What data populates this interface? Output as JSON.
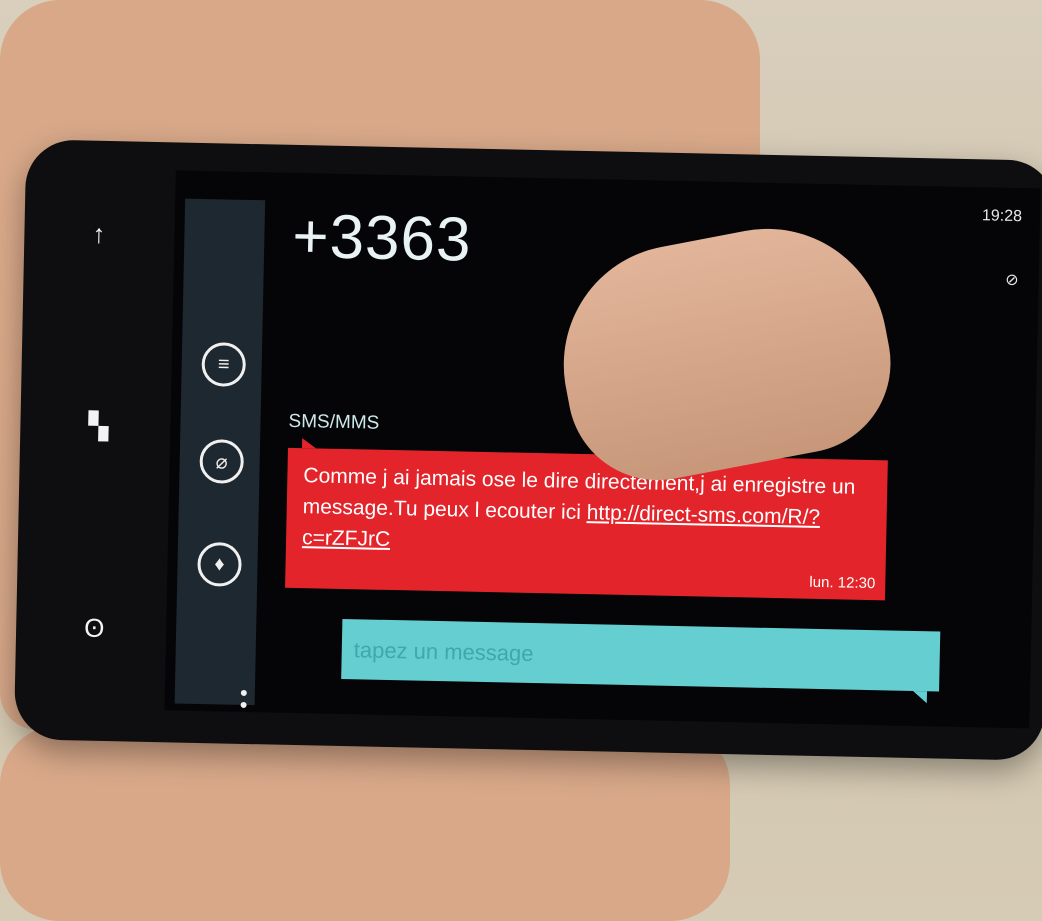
{
  "nav": {
    "back_icon": "back-arrow-icon",
    "windows_icon": "windows-logo-icon",
    "search_icon": "search-icon"
  },
  "appbar": {
    "icons": [
      "conversation-icon",
      "attach-icon",
      "microphone-icon"
    ],
    "more_icon": "more-dots-icon"
  },
  "header": {
    "contact": "+3363",
    "clock": "19:28"
  },
  "thread": {
    "label": "SMS/MMS",
    "message_text": "Comme j ai jamais ose le dire directement,j ai enregistre un message.Tu peux l ecouter ici",
    "message_link": "http://direct-sms.com/R/?c=rZFJrC",
    "timestamp": "lun. 12:30"
  },
  "composer": {
    "placeholder": "tapez un message"
  },
  "colors": {
    "message_bg": "#e3252b",
    "accent": "#65ced0",
    "screen_bg": "#050507"
  }
}
